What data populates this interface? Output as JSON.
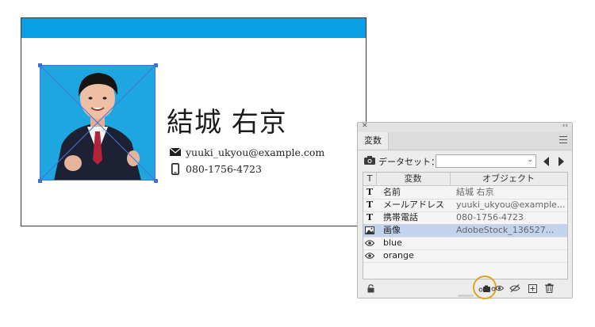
{
  "card": {
    "name": "結城 右京",
    "email": "yuuki_ukyou@example.com",
    "phone": "080-1756-4723",
    "accent_color": "#0ba0e6"
  },
  "panel": {
    "tab_label": "変数",
    "dataset_label": "データセット：",
    "dataset_value": "",
    "columns": {
      "type": "T",
      "variable": "変数",
      "object": "オブジェクト"
    },
    "rows": [
      {
        "type": "T",
        "icon": "text-variable-icon",
        "name": "名前",
        "object": "結城 右京"
      },
      {
        "type": "T",
        "icon": "text-variable-icon",
        "name": "メールアドレス",
        "object": "yuuki_ukyou@example..."
      },
      {
        "type": "T",
        "icon": "text-variable-icon",
        "name": "携帯電話",
        "object": "080-1756-4723"
      },
      {
        "type": "",
        "icon": "image-variable-icon",
        "name": "画像",
        "object": "AdobeStock_136527...",
        "selected": true
      },
      {
        "type": "",
        "icon": "visibility-variable-icon",
        "name": "blue",
        "object": ""
      },
      {
        "type": "",
        "icon": "visibility-variable-icon",
        "name": "orange",
        "object": ""
      }
    ],
    "bottom_icons": [
      "lock-icon",
      "capture-dataset-icon",
      "make-visibility-dynamic-icon",
      "make-static-icon",
      "new-variable-icon",
      "delete-variable-icon"
    ],
    "highlight_color": "#e1a21e",
    "selection_color": "#c3d3ee"
  }
}
